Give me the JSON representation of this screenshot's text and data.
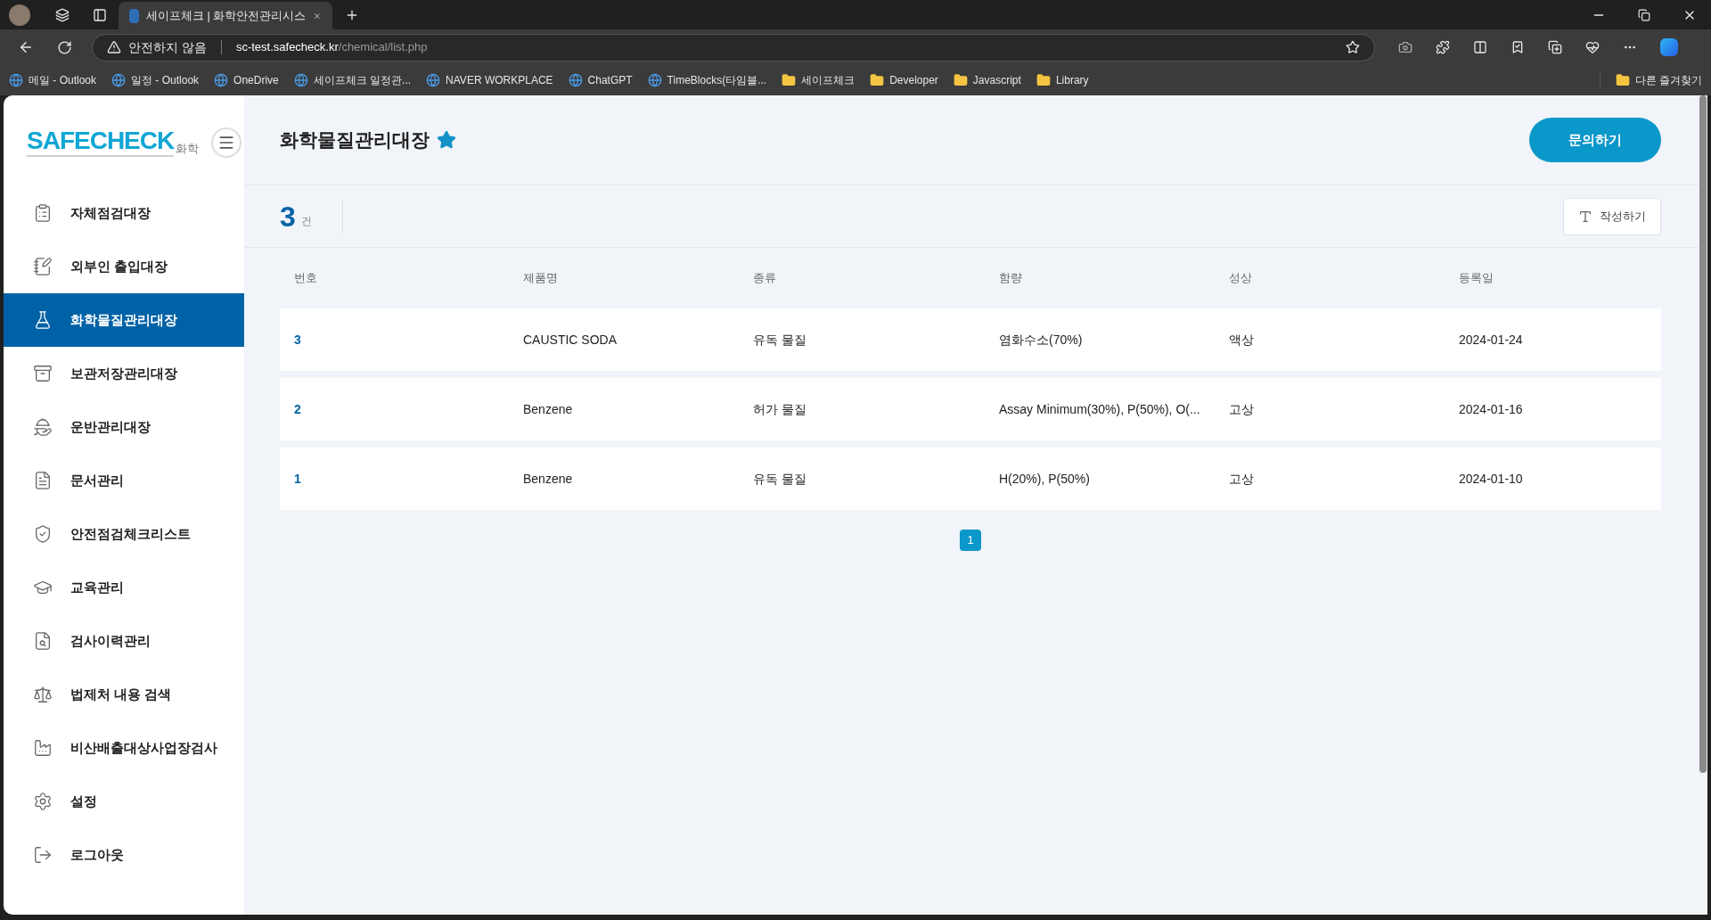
{
  "browser": {
    "tab_title": "세이프체크 | 화학안전관리시스",
    "security_warning": "안전하지 않음",
    "url_host": "sc-test.safecheck.kr",
    "url_path": "/chemical/list.php",
    "bookmarks": [
      {
        "kind": "site",
        "label": "메일 - Outlook"
      },
      {
        "kind": "site",
        "label": "일정 - Outlook"
      },
      {
        "kind": "site",
        "label": "OneDrive"
      },
      {
        "kind": "site",
        "label": "세이프체크 일정관..."
      },
      {
        "kind": "site",
        "label": "NAVER WORKPLACE"
      },
      {
        "kind": "site",
        "label": "ChatGPT"
      },
      {
        "kind": "site",
        "label": "TimeBlocks(타임블..."
      },
      {
        "kind": "folder",
        "label": "세이프체크"
      },
      {
        "kind": "folder",
        "label": "Developer"
      },
      {
        "kind": "folder",
        "label": "Javascript"
      },
      {
        "kind": "folder",
        "label": "Library"
      }
    ],
    "other_favorites": "다른 즐겨찾기"
  },
  "sidebar": {
    "logo": "SAFECHECK",
    "logo_sub": "화학",
    "items": [
      {
        "kind": "clipboard",
        "label": "자체점검대장",
        "selected": false
      },
      {
        "kind": "notepad",
        "label": "외부인 출입대장",
        "selected": false
      },
      {
        "kind": "flask",
        "label": "화학물질관리대장",
        "selected": true
      },
      {
        "kind": "archive",
        "label": "보관저장관리대장",
        "selected": false
      },
      {
        "kind": "cart",
        "label": "운반관리대장",
        "selected": false
      },
      {
        "kind": "document",
        "label": "문서관리",
        "selected": false
      },
      {
        "kind": "shield",
        "label": "안전점검체크리스트",
        "selected": false
      },
      {
        "kind": "cap",
        "label": "교육관리",
        "selected": false
      },
      {
        "kind": "history",
        "label": "검사이력관리",
        "selected": false
      },
      {
        "kind": "law",
        "label": "법제처 내용 검색",
        "selected": false
      },
      {
        "kind": "factory",
        "label": "비산배출대상사업장검사",
        "selected": false
      },
      {
        "kind": "settings",
        "label": "설정",
        "selected": false
      },
      {
        "kind": "logout",
        "label": "로그아웃",
        "selected": false
      }
    ]
  },
  "header": {
    "title": "화학물질관리대장",
    "favorite": true,
    "inquiry_button": "문의하기"
  },
  "summary": {
    "count": "3",
    "unit": "건",
    "write_button": "작성하기"
  },
  "table": {
    "columns": [
      "번호",
      "제품명",
      "종류",
      "함량",
      "성상",
      "등록일"
    ],
    "rows": [
      [
        "3",
        "CAUSTIC SODA",
        "유독 물질",
        "염화수소(70%)",
        "액상",
        "2024-01-24"
      ],
      [
        "2",
        "Benzene",
        "허가 물질",
        "Assay Minimum(30%), P(50%), O(...",
        "고상",
        "2024-01-16"
      ],
      [
        "1",
        "Benzene",
        "유독 물질",
        "H(20%), P(50%)",
        "고상",
        "2024-01-10"
      ]
    ]
  },
  "pagination": [
    {
      "label": "1",
      "selected": true
    }
  ]
}
